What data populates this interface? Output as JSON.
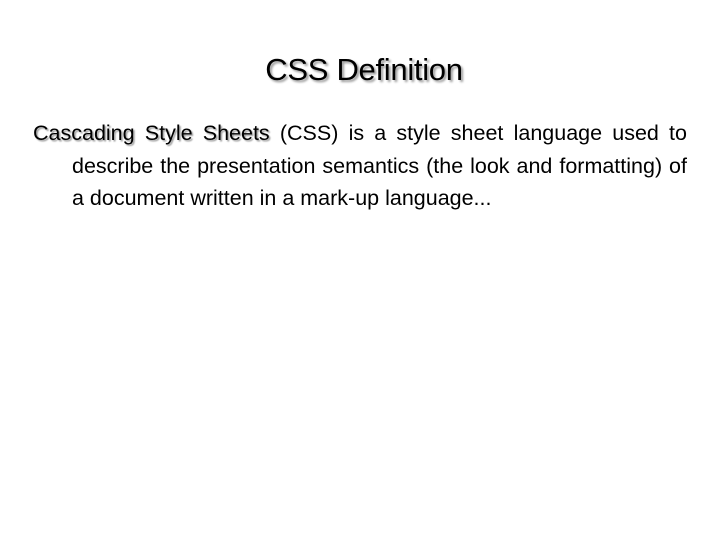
{
  "slide": {
    "title": "CSS Definition",
    "body": {
      "term": "Cascading Style Sheets",
      "text": " (CSS) is a style sheet language used to describe the presentation semantics (the look and formatting) of a document written in a mark-up language..."
    }
  }
}
